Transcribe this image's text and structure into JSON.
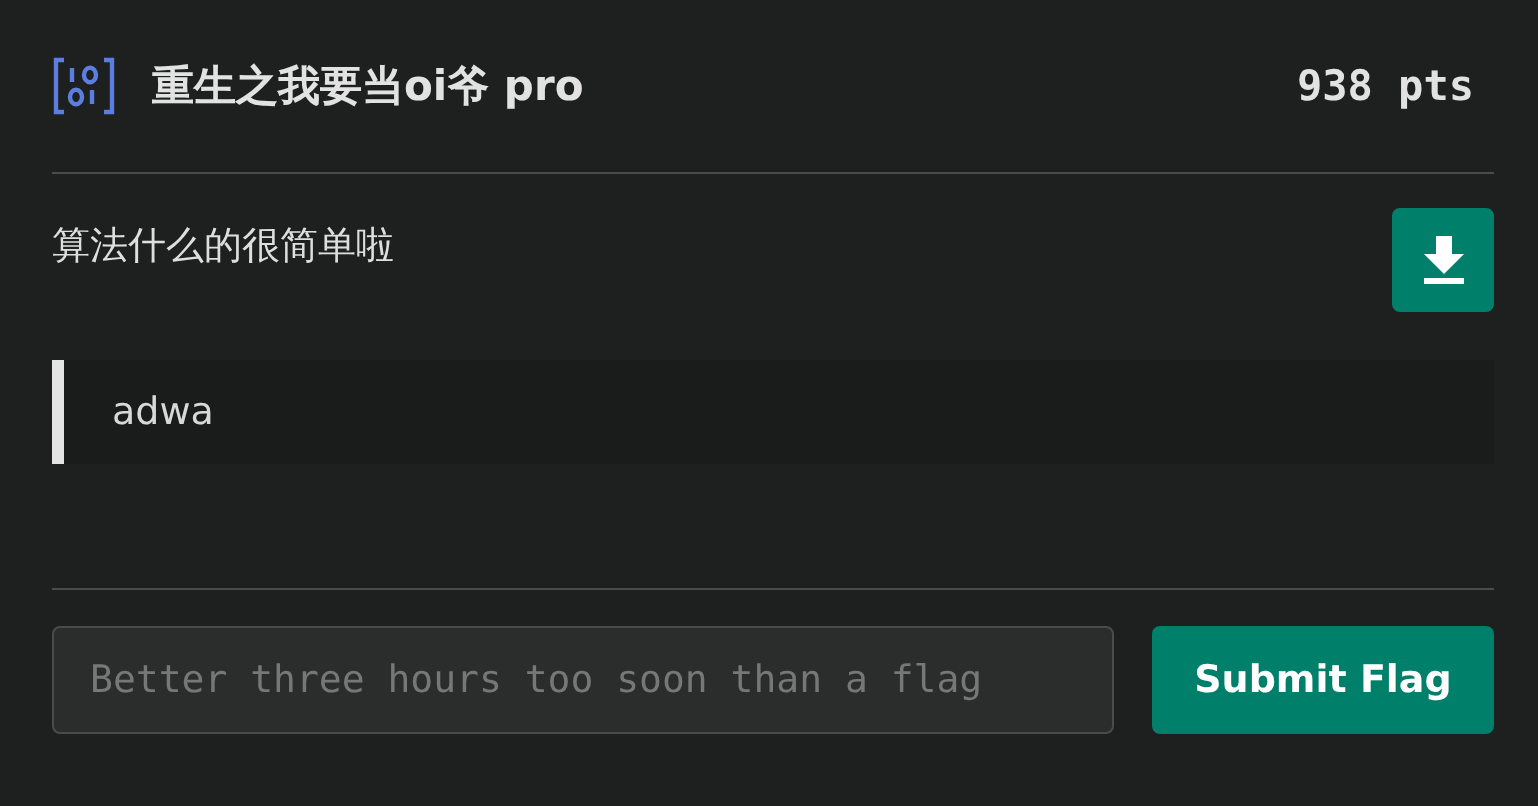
{
  "challenge": {
    "title": "重生之我要当oi爷 pro",
    "points": "938 pts",
    "description": "算法什么的很简单啦",
    "hint": "adwa"
  },
  "flag_input": {
    "placeholder": "Better three hours too soon than a flag"
  },
  "submit_button": {
    "label": "Submit Flag"
  }
}
